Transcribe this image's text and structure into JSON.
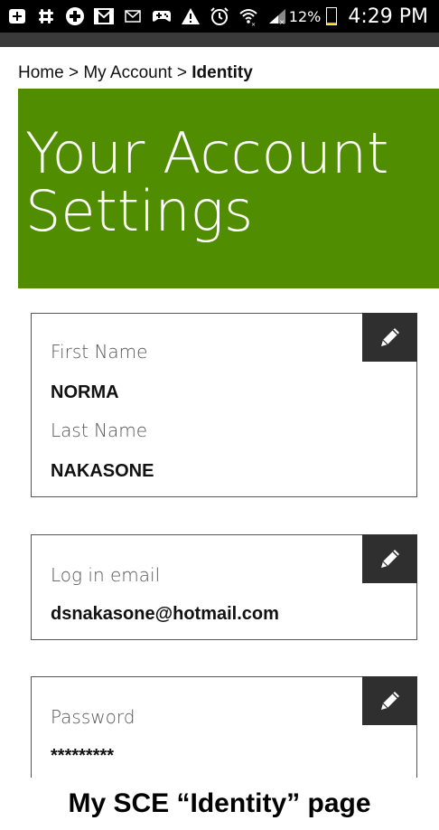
{
  "status_bar": {
    "icons": [
      "notification-icon",
      "slack-icon",
      "add-icon",
      "gmail-icon",
      "mail-icon",
      "game-icon",
      "warning-icon",
      "alarm-icon",
      "wifi-icon",
      "signal-icon"
    ],
    "battery_percent": "12%",
    "battery_level": 0.12,
    "time": "4:29 PM"
  },
  "breadcrumb": {
    "home": "Home",
    "separator": ">",
    "account": "My Account",
    "current": "Identity"
  },
  "hero": {
    "title_line1": "Your Account",
    "title_line2": "Settings",
    "background_color": "#508d00"
  },
  "cards": {
    "name": {
      "first_label": "First Name",
      "first_value": "NORMA",
      "last_label": "Last Name",
      "last_value": "NAKASONE"
    },
    "email": {
      "label": "Log in email",
      "value": "dsnakasone@hotmail.com"
    },
    "password": {
      "label": "Password",
      "value": "*********"
    },
    "edit_icon": "pencil-icon"
  },
  "caption": "My SCE “Identity” page"
}
